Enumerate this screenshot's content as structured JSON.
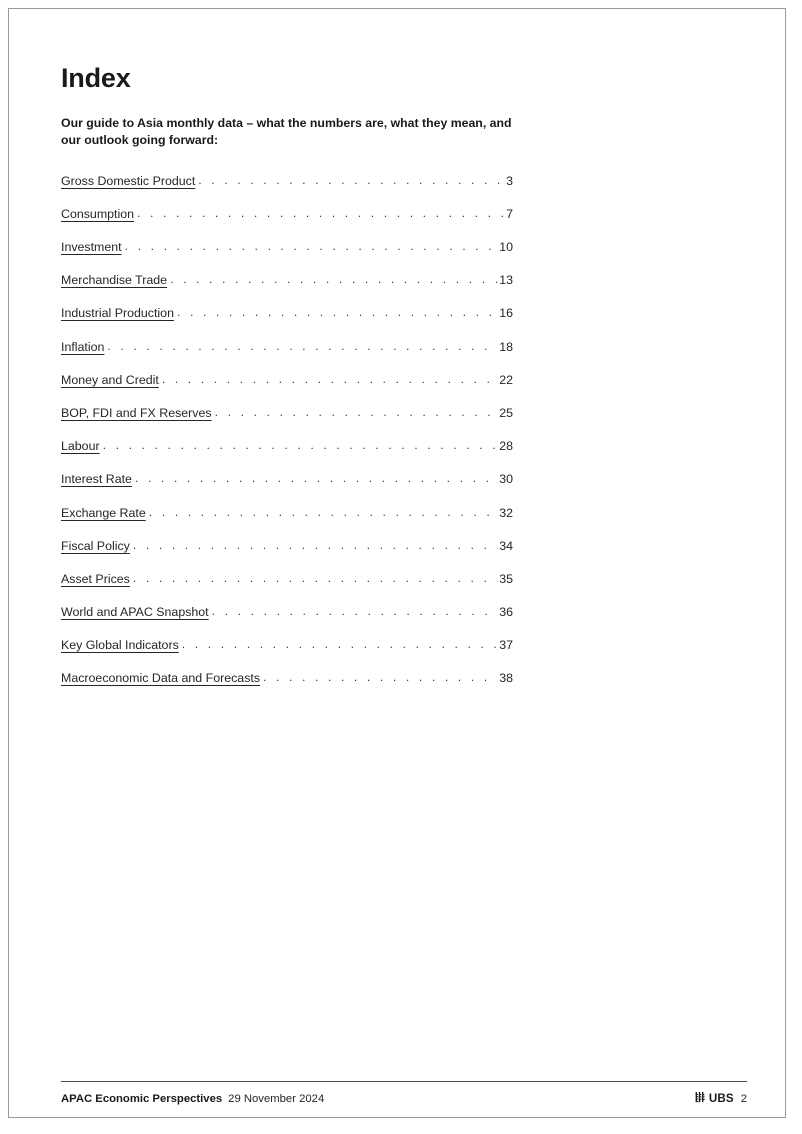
{
  "document": {
    "title": "Index",
    "subtitle": "Our guide to Asia monthly data – what the numbers are, what they mean, and our outlook going forward:"
  },
  "toc": {
    "leader_dots": ". . . . . . . . . . . . . . . . . . . . . . . . . . . . . . . . . . . . . . . . . . . . . . . . . . . . . . . . . . . . . . . . . . . . . . . . . . . . . . . . . . . .",
    "entries": [
      {
        "label": "Gross Domestic Product",
        "page": "3"
      },
      {
        "label": "Consumption",
        "page": "7"
      },
      {
        "label": "Investment",
        "page": "10"
      },
      {
        "label": "Merchandise Trade",
        "page": "13"
      },
      {
        "label": "Industrial Production",
        "page": "16"
      },
      {
        "label": "Inflation",
        "page": "18"
      },
      {
        "label": "Money and Credit",
        "page": "22"
      },
      {
        "label": "BOP, FDI and FX Reserves",
        "page": "25"
      },
      {
        "label": "Labour",
        "page": "28"
      },
      {
        "label": "Interest Rate",
        "page": "30"
      },
      {
        "label": "Exchange Rate",
        "page": "32"
      },
      {
        "label": "Fiscal Policy",
        "page": "34"
      },
      {
        "label": "Asset Prices",
        "page": "35"
      },
      {
        "label": "World and APAC Snapshot",
        "page": "36"
      },
      {
        "label": "Key Global Indicators",
        "page": "37"
      },
      {
        "label": "Macroeconomic Data and Forecasts",
        "page": "38"
      }
    ]
  },
  "footer": {
    "doc_title": "APAC Economic Perspectives",
    "date": "29 November 2024",
    "brand": "UBS",
    "brand_icon": "ubs-three-keys-icon",
    "page_number": "2"
  },
  "colors": {
    "text": "#262626",
    "heading": "#1a1a1a",
    "page_border": "#9a9a9a",
    "rule": "#4d4d4d",
    "background": "#ffffff"
  }
}
